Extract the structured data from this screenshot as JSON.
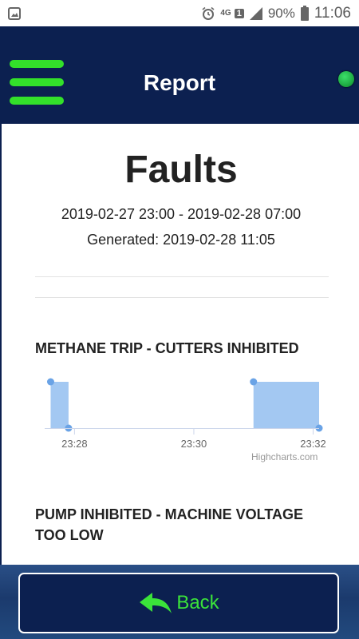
{
  "status_bar": {
    "network": "4G",
    "sim": "1",
    "battery": "90%",
    "time": "11:06",
    "icons": [
      "gallery-icon",
      "alarm-icon",
      "signal-icon",
      "battery-icon"
    ]
  },
  "appbar": {
    "title": "Report",
    "menu_icon": "hamburger-icon",
    "status_color": "#1fc653"
  },
  "report": {
    "title": "Faults",
    "range": "2019-02-27 23:00 - 2019-02-28 07:00",
    "generated": "Generated: 2019-02-28 11:05"
  },
  "sections": [
    {
      "title": "METHANE TRIP - CUTTERS INHIBITED"
    },
    {
      "title": "PUMP INHIBITED - MACHINE VOLTAGE TOO LOW"
    }
  ],
  "chart_data": {
    "type": "area",
    "title": "METHANE TRIP - CUTTERS INHIBITED",
    "xlabel": "",
    "ylabel": "",
    "x_unit": "minutes (clock time)",
    "xlim": [
      "23:27.5",
      "23:32.1"
    ],
    "xticks": [
      "23:28",
      "23:30",
      "23:32"
    ],
    "series": [
      {
        "points": [
          {
            "x": "23:27.6",
            "y": 1
          },
          {
            "x": "23:27.9",
            "y": 0
          },
          {
            "x": "23:31.0",
            "y": 1
          },
          {
            "x": "23:32.1",
            "y": 0
          }
        ]
      }
    ],
    "color": "#a3c8f2",
    "marker_color": "#6aa3e6",
    "credits": "Highcharts.com"
  },
  "footer": {
    "back_label": "Back",
    "back_icon": "back-arrow-icon",
    "accent": "#3be33a"
  }
}
